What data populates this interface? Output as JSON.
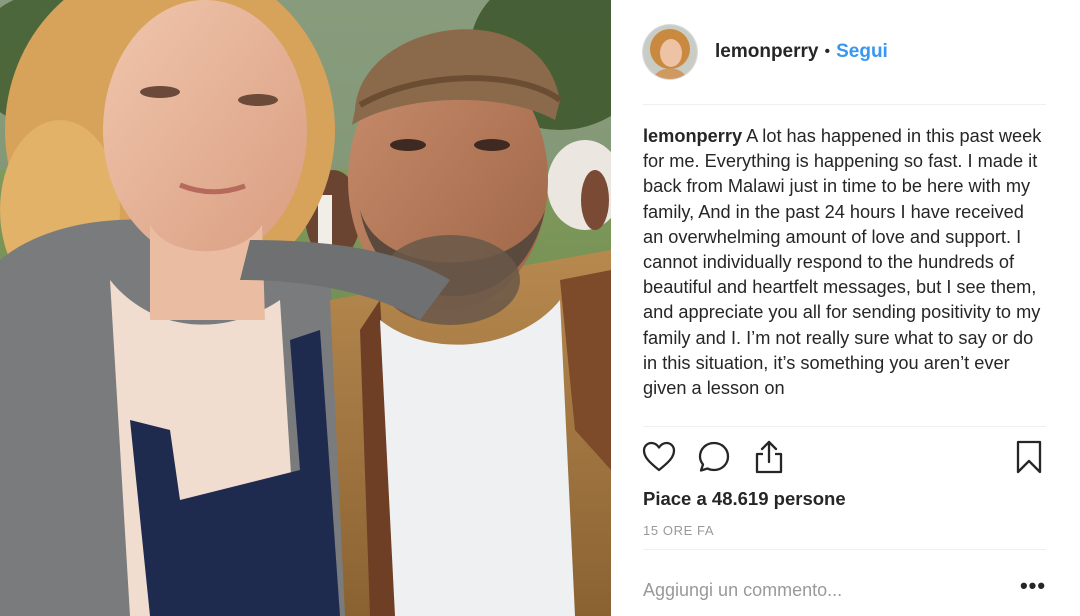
{
  "post": {
    "username": "lemonperry",
    "separator": "•",
    "follow_label": "Segui",
    "caption_username": "lemonperry",
    "caption_text": " A lot has happened in this past week for me. Everything is happening so fast. I made it back from Malawi just in time to be here with my family, And in the past 24 hours I have received an overwhelming amount of love and support. I cannot individually respond to the hundreds of beautiful and heartfelt messages, but I see them, and appreciate you all for sending positivity to my family and I. I’m not really sure what to say or do in this situation, it’s something you aren’t ever given a lesson on",
    "likes_prefix": "Piace a ",
    "likes_count": "48.619",
    "likes_suffix": " persone",
    "timestamp": "15 ORE FA",
    "comment_placeholder": "Aggiungi un commento...",
    "more_label": "•••"
  },
  "icons": {
    "like": "heart-icon",
    "comment": "comment-bubble-icon",
    "share": "share-upload-icon",
    "save": "bookmark-icon",
    "more": "more-options-icon"
  },
  "colors": {
    "follow_blue": "#3897f0",
    "text": "#262626",
    "muted": "#999999",
    "divider": "#efefef"
  }
}
